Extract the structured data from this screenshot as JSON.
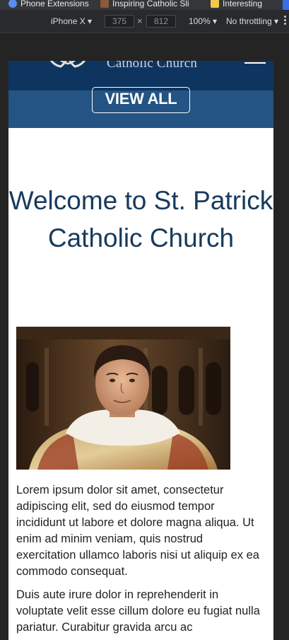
{
  "bookmarks": [
    {
      "label": "Phone Extensions",
      "icon": "globe-icon"
    },
    {
      "label": "Inspiring Catholic Sli",
      "icon": "portrait-thumbnail-icon"
    },
    {
      "label": "Interesting",
      "icon": "folder-icon"
    }
  ],
  "devtools": {
    "device": "iPhone X",
    "width": "375",
    "height": "812",
    "zoom": "100%",
    "throttling": "No throttling"
  },
  "site": {
    "brand": "Catholic Church",
    "view_all_label": "VIEW ALL",
    "welcome_title": "Welcome to St. Patrick Catholic Church",
    "paragraphs": [
      "Lorem ipsum dolor sit amet, consectetur adipiscing elit, sed do eiusmod tempor incididunt ut labore et dolore magna aliqua. Ut enim ad minim veniam, quis nostrud exercitation ullamco laboris nisi ut aliquip ex ea commodo consequat.",
      "Duis aute irure dolor in reprehenderit in voluptate velit esse cillum dolore eu fugiat nulla pariatur. Curabitur gravida arcu ac"
    ]
  },
  "colors": {
    "header_navy": "#0e3560",
    "band_blue": "#245483",
    "title_navy": "#173a5e"
  }
}
